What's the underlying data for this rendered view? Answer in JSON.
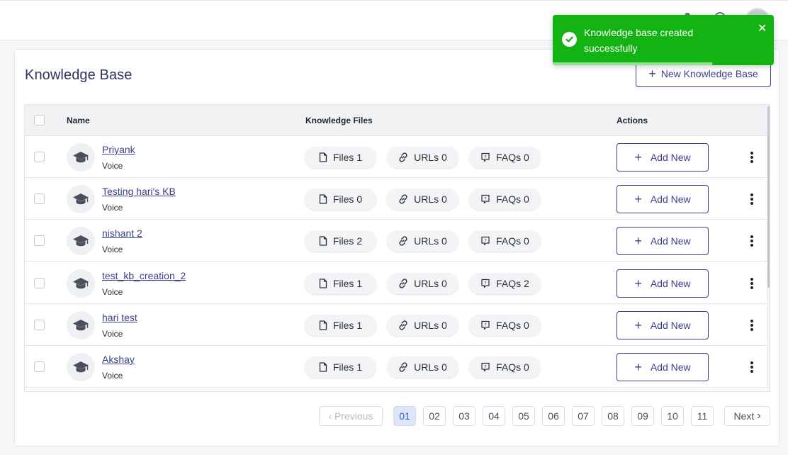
{
  "page": {
    "title": "Knowledge Base",
    "new_button_label": "New Knowledge Base"
  },
  "table": {
    "headers": {
      "name": "Name",
      "files": "Knowledge Files",
      "actions": "Actions"
    },
    "rows": [
      {
        "name": "Priyank",
        "type": "Voice",
        "files": "Files 1",
        "urls": "URLs 0",
        "faqs": "FAQs 0",
        "action": "Add New"
      },
      {
        "name": "Testing hari's KB",
        "type": "Voice",
        "files": "Files 0",
        "urls": "URLs 0",
        "faqs": "FAQs 0",
        "action": "Add New"
      },
      {
        "name": "nishant 2",
        "type": "Voice",
        "files": "Files 2",
        "urls": "URLs 0",
        "faqs": "FAQs 0",
        "action": "Add New"
      },
      {
        "name": "test_kb_creation_2",
        "type": "Voice",
        "files": "Files 1",
        "urls": "URLs 0",
        "faqs": "FAQs 2",
        "action": "Add New"
      },
      {
        "name": "hari test",
        "type": "Voice",
        "files": "Files 1",
        "urls": "URLs 0",
        "faqs": "FAQs 0",
        "action": "Add New"
      },
      {
        "name": "Akshay",
        "type": "Voice",
        "files": "Files 1",
        "urls": "URLs 0",
        "faqs": "FAQs 0",
        "action": "Add New"
      }
    ]
  },
  "pagination": {
    "previous_label": "Previous",
    "next_label": "Next",
    "pages": [
      "01",
      "02",
      "03",
      "04",
      "05",
      "06",
      "07",
      "08",
      "09",
      "10",
      "11"
    ],
    "current_page": "01"
  },
  "toast": {
    "message": "Knowledge base created successfully",
    "type": "success",
    "close_icon": "close-icon",
    "timer_remaining": 0.72
  },
  "icons": {
    "row_avatar": "graduation-cap-icon",
    "files": "file-icon",
    "urls": "link-icon",
    "faqs": "faq-bubble-icon",
    "add": "plus-icon",
    "row_menu": "kebab-menu-icon"
  },
  "colors": {
    "accent": "#3a3f8f",
    "toast_success": "#12b312",
    "active_page_bg": "#dde6f8"
  }
}
